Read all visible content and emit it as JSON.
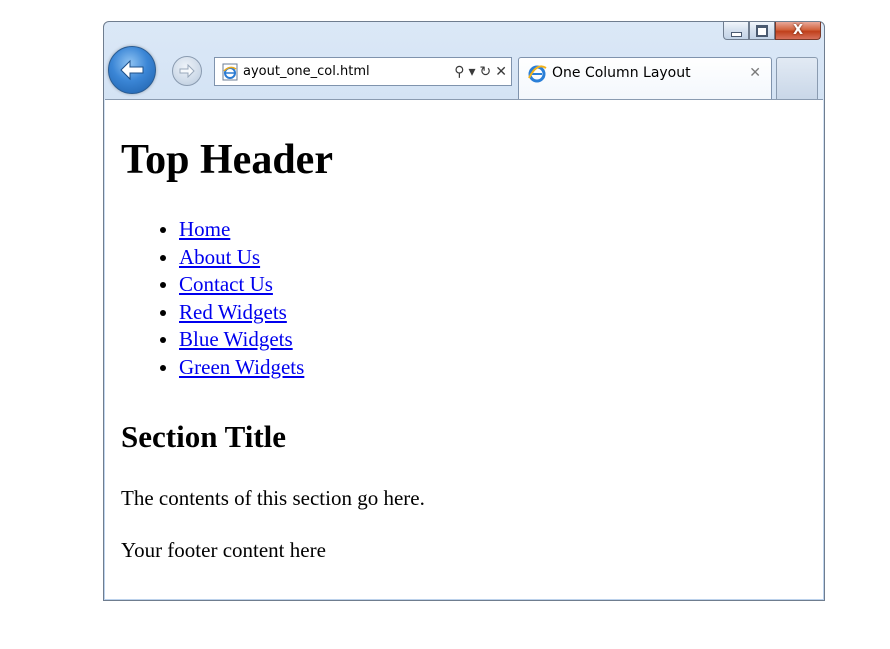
{
  "browser": {
    "address_text": "ayout_one_col.html",
    "tab_title": "One Column Layout",
    "close_symbol": "✕",
    "search_symbol": "⚲",
    "refresh_symbol": "↻",
    "stop_symbol": "✕",
    "dropdown_symbol": "▾",
    "icons": {
      "back": "back-arrow-icon",
      "forward": "forward-arrow-icon",
      "page": "ie-page-icon",
      "tab": "ie-logo-icon"
    }
  },
  "page": {
    "header": "Top Header",
    "nav": [
      {
        "label": "Home"
      },
      {
        "label": "About Us"
      },
      {
        "label": "Contact Us"
      },
      {
        "label": "Red Widgets"
      },
      {
        "label": "Blue Widgets"
      },
      {
        "label": "Green Widgets"
      }
    ],
    "section_title": "Section Title",
    "section_text": "The contents of this section go here.",
    "footer_text": "Your footer content here"
  },
  "colors": {
    "link": "#0000ee",
    "chrome": "#c6d9ef",
    "close_button": "#c0401b"
  }
}
